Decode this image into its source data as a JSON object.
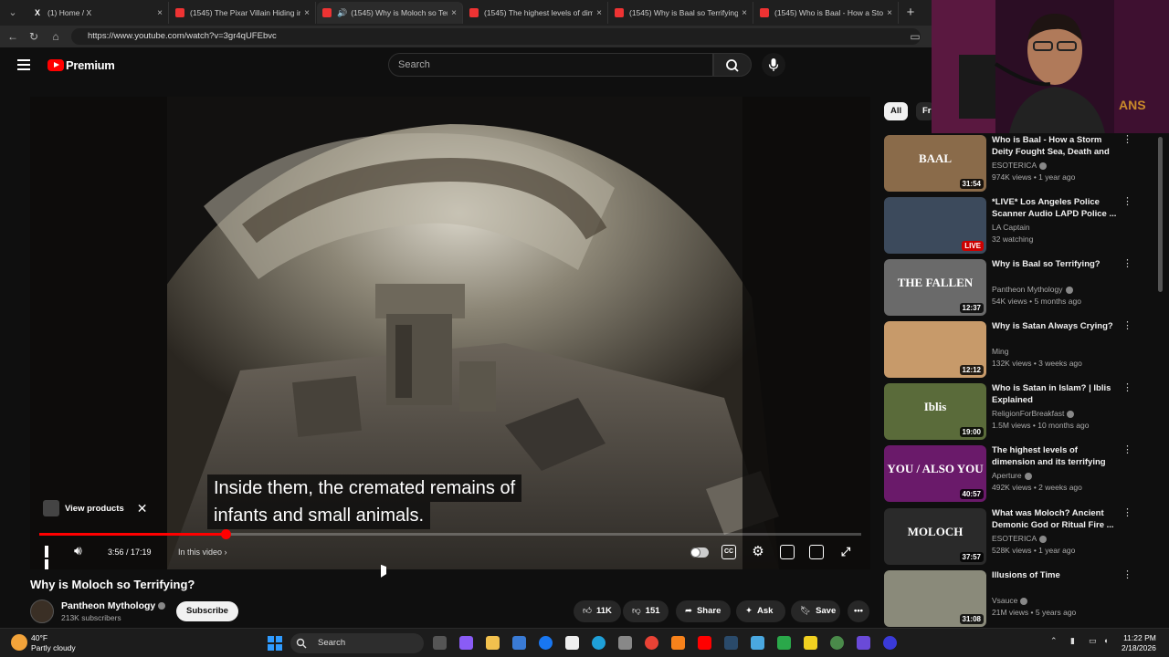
{
  "browser": {
    "tabs": [
      {
        "title": "(1) Home / X",
        "active": false
      },
      {
        "title": "(1545) The Pixar Villain Hiding in A",
        "active": false
      },
      {
        "title": "(1545) Why is Moloch so Terri",
        "active": true
      },
      {
        "title": "(1545) The highest levels of dimen",
        "active": false
      },
      {
        "title": "(1545) Why is Baal so Terrifying? -",
        "active": false
      },
      {
        "title": "(1545) Who is Baal - How a Storm",
        "active": false
      }
    ],
    "url": "https://www.youtube.com/watch?v=3gr4qUFEbvc"
  },
  "masthead": {
    "brand": "Premium",
    "search_placeholder": "Search"
  },
  "player": {
    "caption_line1": "Inside them, the cremated remains of",
    "caption_line2": "infants and small animals.",
    "view_products": "View products",
    "time": "3:56 / 17:19",
    "chapter": "In this video",
    "progress_fraction": 0.227
  },
  "video": {
    "title": "Why is Moloch so Terrifying?",
    "channel": "Pantheon Mythology",
    "subscribers": "213K subscribers",
    "subscribe_label": "Subscribe",
    "likes": "11K",
    "dislikes": "151",
    "share_label": "Share",
    "ask_label": "Ask",
    "save_label": "Save"
  },
  "rail": {
    "chips": [
      "All",
      "Fr"
    ],
    "items": [
      {
        "title": "Who is Baal - How a Storm Deity Fought Sea, Death and Yahwe...",
        "channel": "ESOTERICA",
        "meta": "974K views • 1 year ago",
        "duration": "31:54",
        "thumb_text": "BAAL",
        "thumb_color": "#8a6b4a",
        "verified": true
      },
      {
        "title": "*LIVE* Los Angeles Police Scanner Audio LAPD Police ...",
        "channel": "LA Captain",
        "meta": "32 watching",
        "duration": "LIVE",
        "thumb_text": "",
        "thumb_color": "#3c4a5c",
        "verified": false
      },
      {
        "title": "Why is Baal so Terrifying?",
        "channel": "Pantheon Mythology",
        "meta": "54K views • 5 months ago",
        "duration": "12:37",
        "thumb_text": "THE FALLEN",
        "thumb_color": "#6a6a6a",
        "verified": true
      },
      {
        "title": "Why is Satan Always Crying?",
        "channel": "Ming",
        "meta": "132K views • 3 weeks ago",
        "duration": "12:12",
        "thumb_text": "",
        "thumb_color": "#c79a6a",
        "verified": false
      },
      {
        "title": "Who is Satan in Islam? | Iblis Explained",
        "channel": "ReligionForBreakfast",
        "meta": "1.5M views • 10 months ago",
        "duration": "19:00",
        "thumb_text": "Iblis",
        "thumb_color": "#5a6b3a",
        "verified": true
      },
      {
        "title": "The highest levels of dimension and its terrifying consequences",
        "channel": "Aperture",
        "meta": "492K views • 2 weeks ago",
        "duration": "40:57",
        "thumb_text": "YOU / ALSO YOU",
        "thumb_color": "#6a1a6a",
        "verified": true
      },
      {
        "title": "What was Moloch? Ancient Demonic God or Ritual Fire ...",
        "channel": "ESOTERICA",
        "meta": "528K views • 1 year ago",
        "duration": "37:57",
        "thumb_text": "MOLOCH",
        "thumb_color": "#2a2a2a",
        "verified": true
      },
      {
        "title": "Illusions of Time",
        "channel": "Vsauce",
        "meta": "21M views • 5 years ago",
        "duration": "31:08",
        "thumb_text": "",
        "thumb_color": "#8a8a7a",
        "verified": true
      }
    ]
  },
  "taskbar": {
    "temp": "40°F",
    "weather": "Partly cloudy",
    "search_label": "Search",
    "time": "11:22 PM",
    "date": "2/18/2026"
  },
  "colors": {
    "accent": "#ff0000",
    "background": "#0f0f0f",
    "chip_selected": "#f1f1f1"
  }
}
